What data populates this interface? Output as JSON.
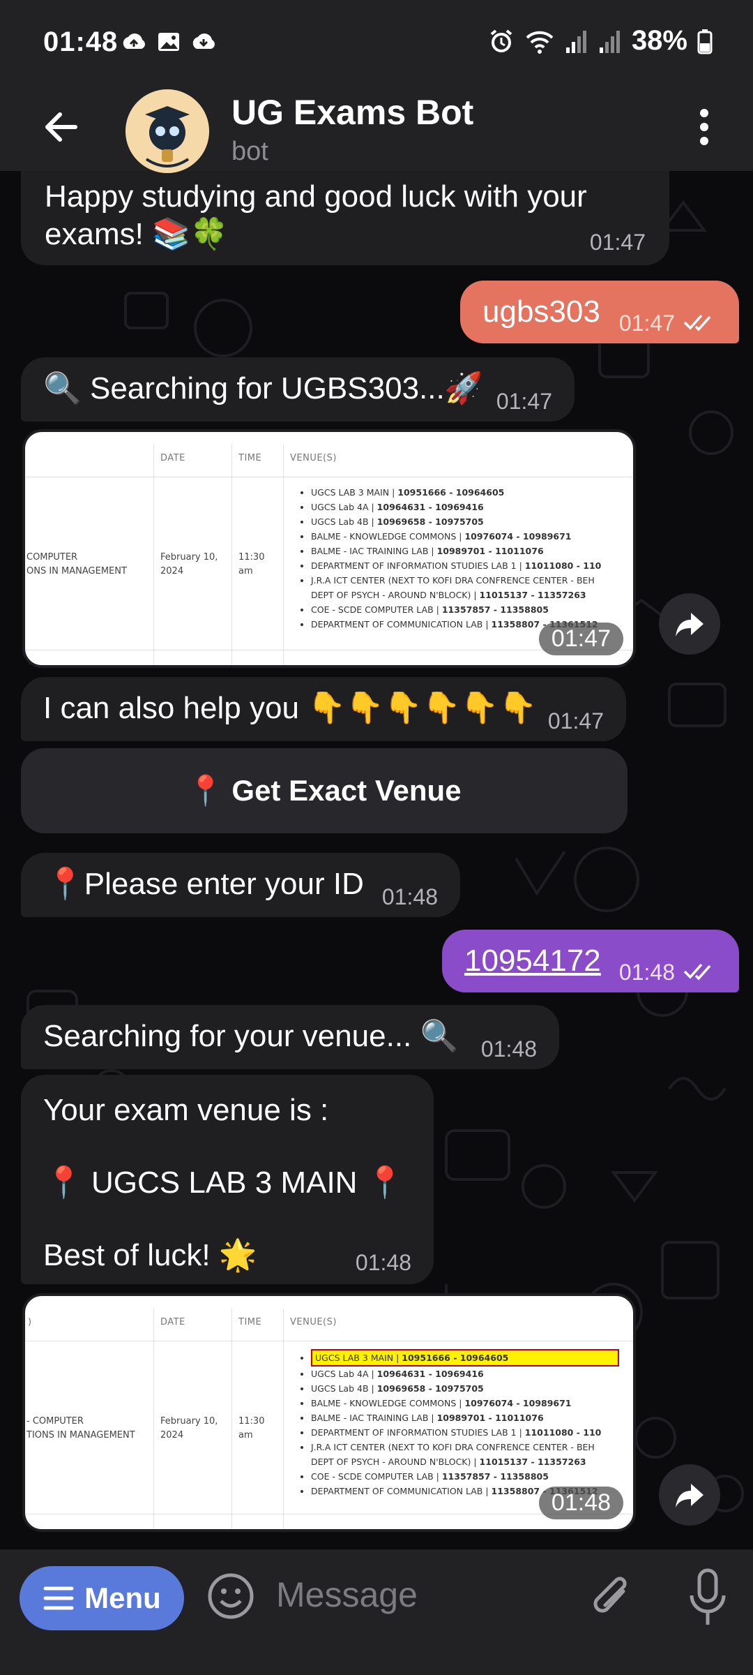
{
  "status": {
    "time": "01:48",
    "battery": "38%",
    "left_icons": [
      "cloud-upload-icon",
      "image-icon",
      "cloud-download-icon"
    ],
    "right_icons": [
      "alarm-icon",
      "wifi-icon",
      "signal-icon",
      "signal-icon",
      "battery-icon"
    ]
  },
  "header": {
    "title": "UG Exams Bot",
    "subtitle": "bot"
  },
  "messages": {
    "m1_text": "Happy studying and good luck with your exams! 📚🍀",
    "m1_time": "01:47",
    "m2_text": "ugbs303",
    "m2_time": "01:47",
    "m3_text": "🔍 Searching for UGBS303...🚀",
    "m3_time": "01:47",
    "img1_time": "01:47",
    "m4_text": "I can also help you 👇👇👇👇👇👇",
    "m4_time": "01:47",
    "button_label": "📍 Get Exact Venue",
    "m5_text": "📍Please enter your ID",
    "m5_time": "01:48",
    "m6_text": "10954172",
    "m6_time": "01:48",
    "m7_text": "Searching for your venue... 🔍",
    "m7_time": "01:48",
    "m8_line1": "Your exam venue is :",
    "m8_line2": "📍 UGCS LAB 3 MAIN 📍",
    "m8_line3": "Best of luck! 🌟",
    "m8_time": "01:48",
    "img2_time": "01:48"
  },
  "table": {
    "headers": [
      "DATE",
      "TIME",
      "VENUE(S)"
    ],
    "course_line1": "COMPUTER",
    "course_line2": "ONS IN MANAGEMENT",
    "course2_line1": "- COMPUTER",
    "course2_line2": "TIONS IN MANAGEMENT",
    "date": "February 10, 2024",
    "time": "11:30 am",
    "venues": [
      {
        "name": "UGCS LAB 3 MAIN | ",
        "range": "10951666 - 10964605"
      },
      {
        "name": "UGCS Lab 4A | ",
        "range": "10964631 - 10969416"
      },
      {
        "name": "UGCS Lab 4B | ",
        "range": "10969658 - 10975705"
      },
      {
        "name": "BALME - KNOWLEDGE COMMONS | ",
        "range": "10976074 - 10989671"
      },
      {
        "name": "BALME - IAC TRAINING LAB | ",
        "range": "10989701 - 11011076"
      },
      {
        "name": "DEPARTMENT OF INFORMATION STUDIES LAB 1 | ",
        "range": "11011080 - 110"
      },
      {
        "name": "J.R.A ICT CENTER (NEXT TO KOFI DRA CONFRENCE CENTER - BEH",
        "range": ""
      },
      {
        "name": "DEPT OF PSYCH - AROUND N'BLOCK) | ",
        "range": "11015137 - 11357263"
      },
      {
        "name": "COE - SCDE COMPUTER LAB | ",
        "range": "11357857 - 11358805"
      },
      {
        "name": "DEPARTMENT OF COMMUNICATION LAB | ",
        "range": "11358807 - 11361512"
      }
    ],
    "header_partial": ")"
  },
  "composer": {
    "menu_label": "Menu",
    "placeholder": "Message"
  }
}
